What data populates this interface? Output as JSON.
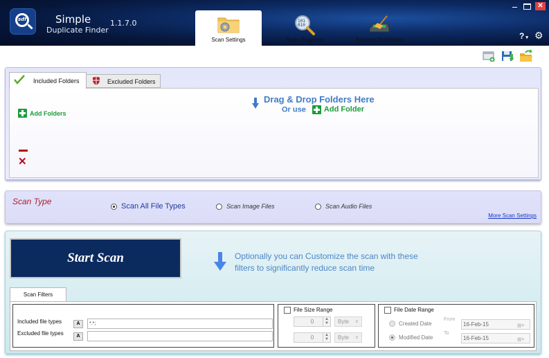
{
  "app": {
    "title": "Simple",
    "subtitle": "Duplicate Finder",
    "version": "1.1.7.0"
  },
  "nav_tabs": [
    {
      "label": "Scan Settings",
      "icon": "folder-gear-icon",
      "active": true
    },
    {
      "label": "Scan Progress",
      "icon": "binary-magnifier-icon",
      "active": false
    },
    {
      "label": "Resolve Duplicates",
      "icon": "drive-broom-icon",
      "active": false
    }
  ],
  "window_controls": {
    "minimize": "–",
    "maximize": "□",
    "close": "✕"
  },
  "header_buttons": {
    "help": "?",
    "help_dropdown": "▾",
    "settings": "⚙"
  },
  "toolbar": {
    "icons": [
      "new-window-icon",
      "save-icon",
      "open-folder-icon"
    ]
  },
  "folders": {
    "tabs": [
      {
        "label": "Included Folders",
        "icon": "checkmark-icon",
        "active": true
      },
      {
        "label": "Excluded Folders",
        "icon": "shield-icon",
        "active": false
      }
    ],
    "add_folders_label": "Add Folders",
    "drop_title": "Drag & Drop Folders Here",
    "drop_or_use": "Or use",
    "drop_add_folder": "Add Folder"
  },
  "scan_type": {
    "title": "Scan Type",
    "options": [
      {
        "label": "Scan All File Types",
        "selected": true
      },
      {
        "label": "Scan Image Files",
        "selected": false
      },
      {
        "label": "Scan Audio Files",
        "selected": false
      }
    ],
    "more_link": "More Scan Settings"
  },
  "scan": {
    "start_button": "Start Scan",
    "hint_line1": "Optionally you can Customize the scan with these",
    "hint_line2": "filters to significantly reduce scan time"
  },
  "filters": {
    "tab_label": "Scan Filters",
    "included_label": "Included file types",
    "included_value": "*.*;",
    "excluded_label": "Excluded file types",
    "excluded_value": "",
    "a_button": "A",
    "size_range": {
      "label": "File Size Range",
      "checked": false,
      "min_value": "0",
      "max_value": "0",
      "min_unit": "Byte",
      "max_unit": "Byte"
    },
    "date_range": {
      "label": "File Date Range",
      "checked": false,
      "created_label": "Created Date",
      "modified_label": "Modified Date",
      "selected": "Modified Date",
      "from_label": "From",
      "to_label": "To",
      "from_value": "16-Feb-15",
      "to_value": "16-Feb-15"
    }
  }
}
